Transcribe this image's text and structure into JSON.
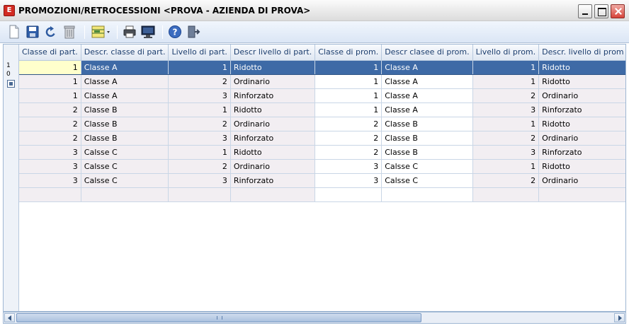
{
  "window": {
    "title": "PROMOZIONI/RETROCESSIONI <PROVA - AZIENDA DI PROVA>",
    "icon_letter": "E"
  },
  "toolbar": {
    "buttons": [
      {
        "name": "new-icon"
      },
      {
        "name": "save-icon"
      },
      {
        "name": "undo-icon"
      },
      {
        "name": "delete-icon"
      },
      {
        "name": "grid-options-icon"
      },
      {
        "name": "print-icon"
      },
      {
        "name": "preview-icon"
      },
      {
        "name": "help-icon"
      },
      {
        "name": "exit-icon"
      }
    ]
  },
  "row_indicator": {
    "line1": "1",
    "line2": "0"
  },
  "grid": {
    "columns": [
      "Classe di part.",
      "Descr. classe di  part.",
      "Livello di part.",
      "Descr livello di part.",
      "Classe di prom.",
      "Descr clasee di prom.",
      "Livello di prom.",
      "Descr. livello di prom",
      "Classe di retroce"
    ],
    "rows": [
      [
        "1",
        "Classe A",
        "1",
        "Ridotto",
        "1",
        "Classe A",
        "1",
        "Ridotto",
        ""
      ],
      [
        "1",
        "Classe A",
        "2",
        "Ordinario",
        "1",
        "Classe A",
        "1",
        "Ridotto",
        ""
      ],
      [
        "1",
        "Classe A",
        "3",
        "Rinforzato",
        "1",
        "Classe A",
        "2",
        "Ordinario",
        ""
      ],
      [
        "2",
        "Classe B",
        "1",
        "Ridotto",
        "1",
        "Classe A",
        "3",
        "Rinforzato",
        ""
      ],
      [
        "2",
        "Classe B",
        "2",
        "Ordinario",
        "2",
        "Classe B",
        "1",
        "Ridotto",
        ""
      ],
      [
        "2",
        "Classe B",
        "3",
        "Rinforzato",
        "2",
        "Classe B",
        "2",
        "Ordinario",
        ""
      ],
      [
        "3",
        "Calsse C",
        "1",
        "Ridotto",
        "2",
        "Classe B",
        "3",
        "Rinforzato",
        ""
      ],
      [
        "3",
        "Calsse C",
        "2",
        "Ordinario",
        "3",
        "Calsse C",
        "1",
        "Ridotto",
        ""
      ],
      [
        "3",
        "Calsse C",
        "3",
        "Rinforzato",
        "3",
        "Calsse C",
        "2",
        "Ordinario",
        ""
      ],
      [
        "",
        "",
        "",
        "",
        "",
        "",
        "",
        "",
        ""
      ]
    ],
    "selected_row": 0
  },
  "colors": {
    "selection": "#3e6aa6",
    "current_cell": "#ffffcc",
    "header_text": "#1b3d6d"
  }
}
